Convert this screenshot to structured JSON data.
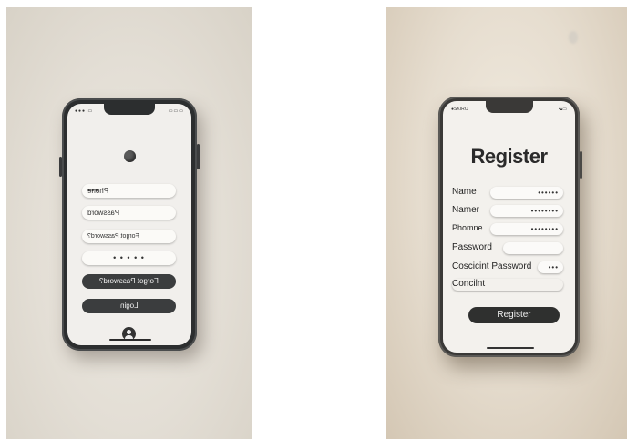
{
  "left_phone": {
    "status_left": "●●● ▭",
    "status_right": "▭▭▭",
    "fields": [
      {
        "text": "Phone",
        "dots": "•••"
      },
      {
        "text": "Password",
        "dots": ""
      },
      {
        "text": "Forgot Password?",
        "dots": ""
      },
      {
        "text": "",
        "dots": "• • • • •"
      }
    ],
    "forgot_button_label": "Forgot Password?",
    "login_button_label": "Login"
  },
  "right_phone": {
    "status_left": "●SKIRO",
    "status_right": "▪▴▭",
    "title": "Register",
    "rows": [
      {
        "label": "Name",
        "value": "••••••"
      },
      {
        "label": "Namer",
        "value": "••••••••"
      },
      {
        "label": "Phomne",
        "value": "••••••••"
      },
      {
        "label": "Password",
        "value": ""
      },
      {
        "label": "Coscicint Password",
        "value": "•••"
      },
      {
        "label": "Concilnt",
        "value": ""
      }
    ],
    "register_button_label": "Register"
  }
}
